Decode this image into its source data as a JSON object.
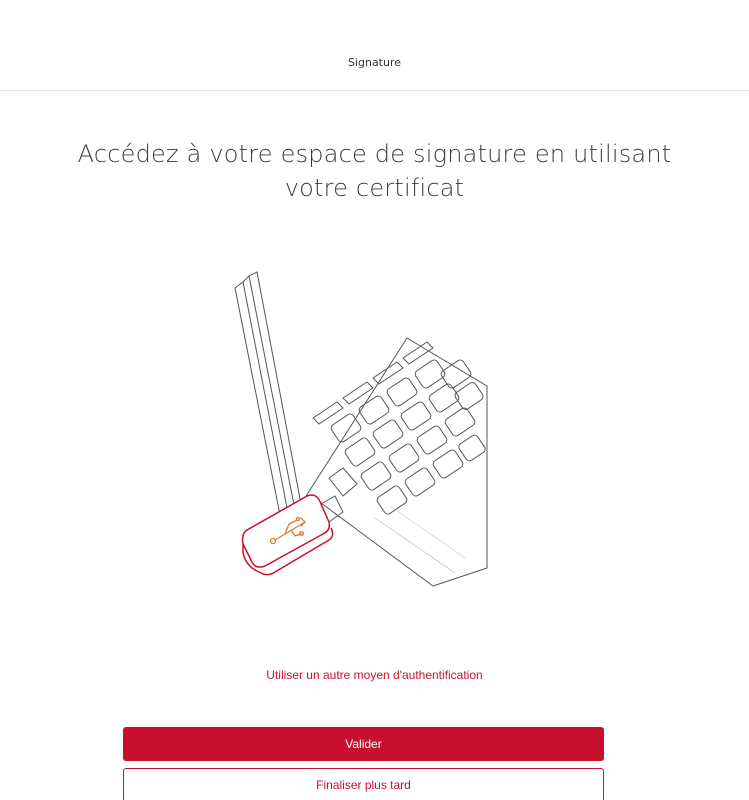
{
  "header": {
    "title": "Signature"
  },
  "main": {
    "headline_line1": "Accédez à votre espace de signature en utilisant",
    "headline_line2": "votre certificat",
    "illustration_icon": "laptop-usb-key-illustration",
    "alt_auth_link": "Utiliser un autre moyen d'authentification",
    "validate_label": "Valider",
    "later_label": "Finaliser plus tard"
  },
  "colors": {
    "accent": "#c8102e",
    "usb_symbol": "#e07a2e",
    "text": "#3a3a3a",
    "divider": "#e2e2e2"
  }
}
